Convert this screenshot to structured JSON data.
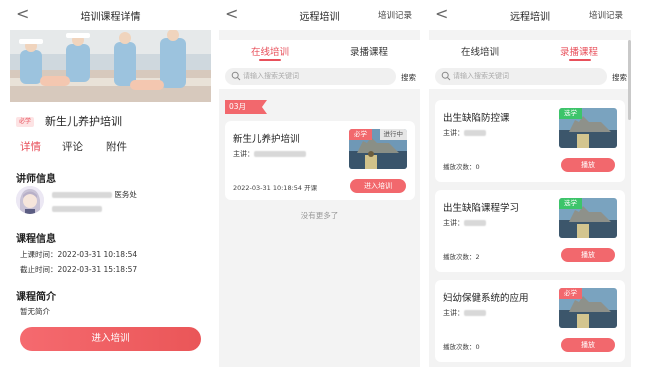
{
  "detail": {
    "back": "<",
    "title": "培训课程详情",
    "required_badge": "必学",
    "course_title": "新生儿养护培训",
    "tabs": [
      "详情",
      "评论",
      "附件"
    ],
    "lecturer_section": "讲师信息",
    "lecturer_dept": "医务处",
    "course_info_section": "课程信息",
    "start_time": "上课时间：2022-03-31 10:18:54",
    "end_time": "截止时间：2022-03-31 15:18:57",
    "intro_section": "课程简介",
    "intro_text": "暂无简介",
    "enter_button": "进入培训"
  },
  "online": {
    "back": "<",
    "title": "远程培训",
    "records": "培训记录",
    "tabs": [
      "在线培训",
      "录播课程"
    ],
    "search_placeholder": "请输入搜索关键词",
    "search_button": "搜索",
    "month": "03月",
    "card": {
      "title": "新生儿养护培训",
      "lecturer_label": "主讲：",
      "tag_required": "必学",
      "tag_status": "进行中",
      "time": "2022-03-31 10:18:54 开课",
      "enter_button": "进入培训"
    },
    "no_more": "没有更多了"
  },
  "recorded": {
    "back": "<",
    "title": "远程培训",
    "records": "培训记录",
    "tabs": [
      "在线培训",
      "录播课程"
    ],
    "search_placeholder": "请输入搜索关键词",
    "search_button": "搜索",
    "lecturer_label": "主讲：",
    "play_button": "播放",
    "items": [
      {
        "title": "出生缺陷防控课",
        "tag": "选学",
        "plays": "播放次数：0"
      },
      {
        "title": "出生缺陷课程学习",
        "tag": "选学",
        "plays": "播放次数：2"
      },
      {
        "title": "妇幼保健系统的应用",
        "tag": "必学",
        "plays": "播放次数：0"
      }
    ]
  },
  "colors": {
    "accent": "#e8505b",
    "required_tag": "#f2686d",
    "elective_tag": "#3dc46a",
    "page_bg": "#f3f3f3"
  },
  "icons": [
    "chevron-left-icon",
    "search-icon",
    "lecturer-avatar"
  ]
}
